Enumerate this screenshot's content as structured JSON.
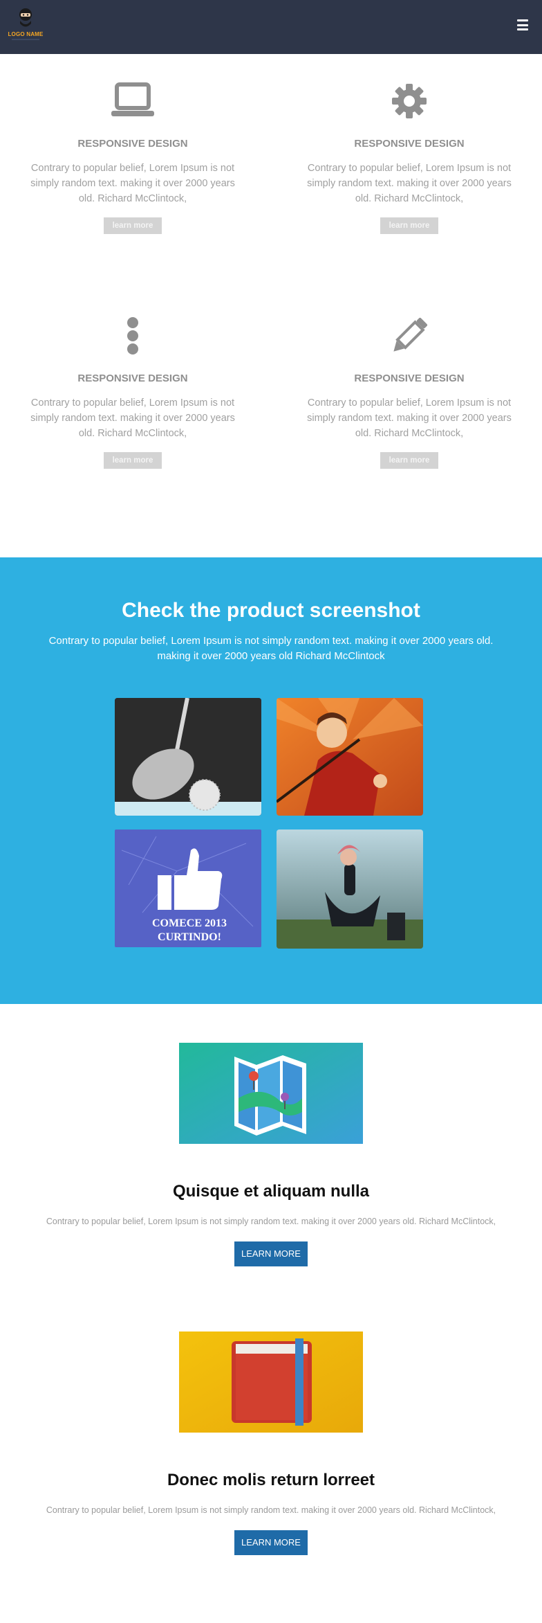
{
  "header": {
    "logo_text": "LOGO NAME",
    "menu_icon": "hamburger-menu-icon"
  },
  "features": [
    {
      "icon": "laptop-icon",
      "title": "RESPONSIVE DESIGN",
      "text": "Contrary to popular belief, Lorem Ipsum is not simply random text. making it over 2000 years old. Richard McClintock,",
      "button": "learn more"
    },
    {
      "icon": "gear-icon",
      "title": "RESPONSIVE DESIGN",
      "text": "Contrary to popular belief, Lorem Ipsum is not simply random text. making it over 2000 years old. Richard McClintock,",
      "button": "learn more"
    },
    {
      "icon": "vertical-ellipsis-icon",
      "title": "RESPONSIVE DESIGN",
      "text": "Contrary to popular belief, Lorem Ipsum is not simply random text. making it over 2000 years old. Richard McClintock,",
      "button": "learn more"
    },
    {
      "icon": "pencil-icon",
      "title": "RESPONSIVE DESIGN",
      "text": "Contrary to popular belief, Lorem Ipsum is not simply random text. making it over 2000 years old. Richard McClintock,",
      "button": "learn more"
    }
  ],
  "product": {
    "title": "Check the product screenshot",
    "text": "Contrary to popular belief, Lorem Ipsum is not simply random text. making it over 2000 years old. making it over 2000 years old Richard McClintock",
    "screenshots": [
      {
        "name": "golf-club-image"
      },
      {
        "name": "man-with-umbrella-image"
      },
      {
        "name": "facebook-like-image",
        "caption_line1": "COMECE 2013",
        "caption_line2": "CURTINDO!"
      },
      {
        "name": "woman-dancing-image"
      }
    ]
  },
  "articles": [
    {
      "image": "map-icon",
      "title": "Quisque et aliquam nulla",
      "text": "Contrary to popular belief, Lorem Ipsum is not simply random text. making it over 2000 years old. Richard McClintock,",
      "button": "LEARN MORE"
    },
    {
      "image": "book-icon",
      "title": "Donec molis return lorreet",
      "text": "Contrary to popular belief, Lorem Ipsum is not simply random text. making it over 2000 years old. Richard McClintock,",
      "button": "LEARN MORE"
    }
  ],
  "colors": {
    "header_bg": "#2e3649",
    "product_bg": "#2eb0e1",
    "button_blue": "#1f6ba8",
    "button_gray": "#d3d3d3",
    "logo_orange": "#f5a623"
  }
}
